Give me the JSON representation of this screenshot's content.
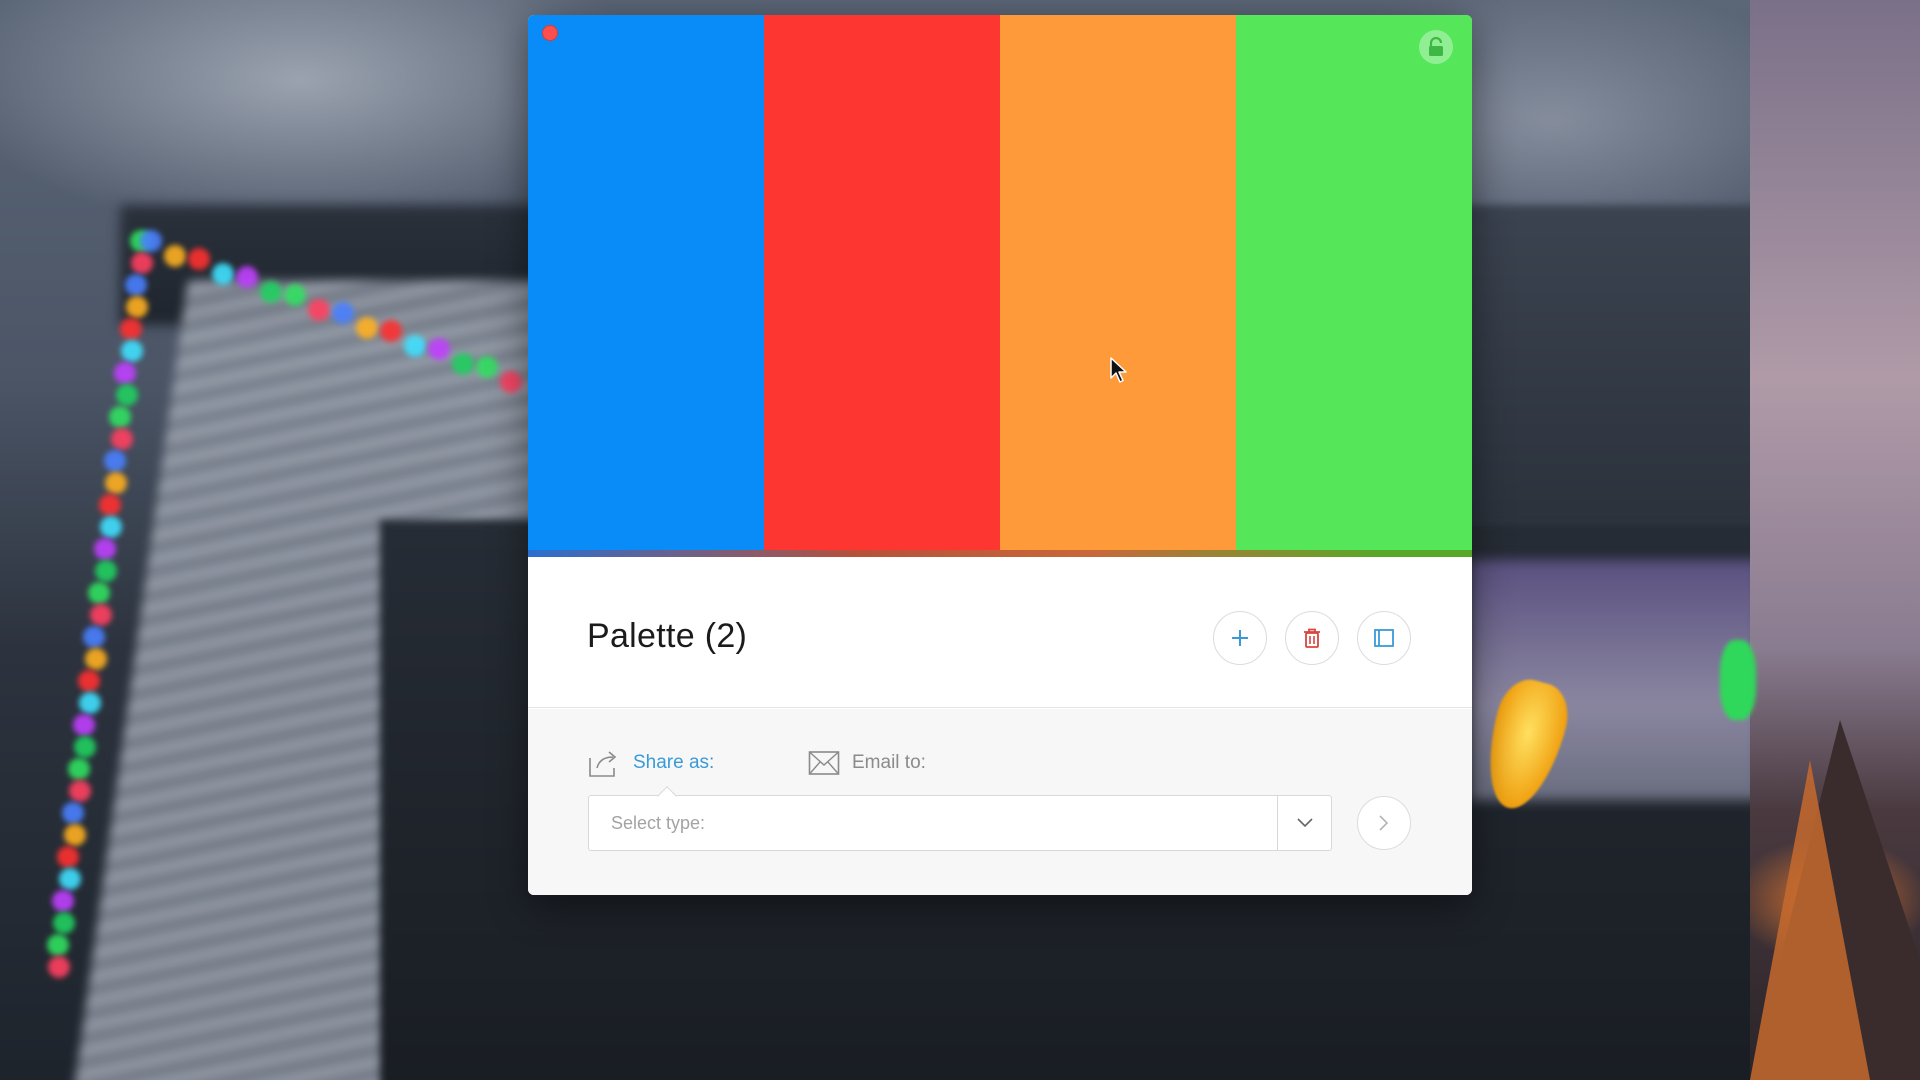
{
  "window": {
    "title": "Palette (2)"
  },
  "swatches": [
    {
      "name": "blue",
      "color": "#0A8CF8"
    },
    {
      "name": "red",
      "color": "#FE3631"
    },
    {
      "name": "orange",
      "color": "#FE9A3A"
    },
    {
      "name": "green",
      "color": "#56E65A"
    }
  ],
  "toolbar": {
    "add_icon": "plus-icon",
    "delete_icon": "trash-icon",
    "expand_icon": "fullscreen-icon"
  },
  "share": {
    "share_as_label": "Share as:",
    "email_to_label": "Email to:",
    "select_placeholder": "Select type:",
    "share_icon": "share-icon",
    "email_icon": "envelope-icon",
    "go_icon": "chevron-right-icon"
  },
  "colors": {
    "accent": "#3A9AD9",
    "delete": "#D9463E",
    "close": "#FE4E4E"
  }
}
